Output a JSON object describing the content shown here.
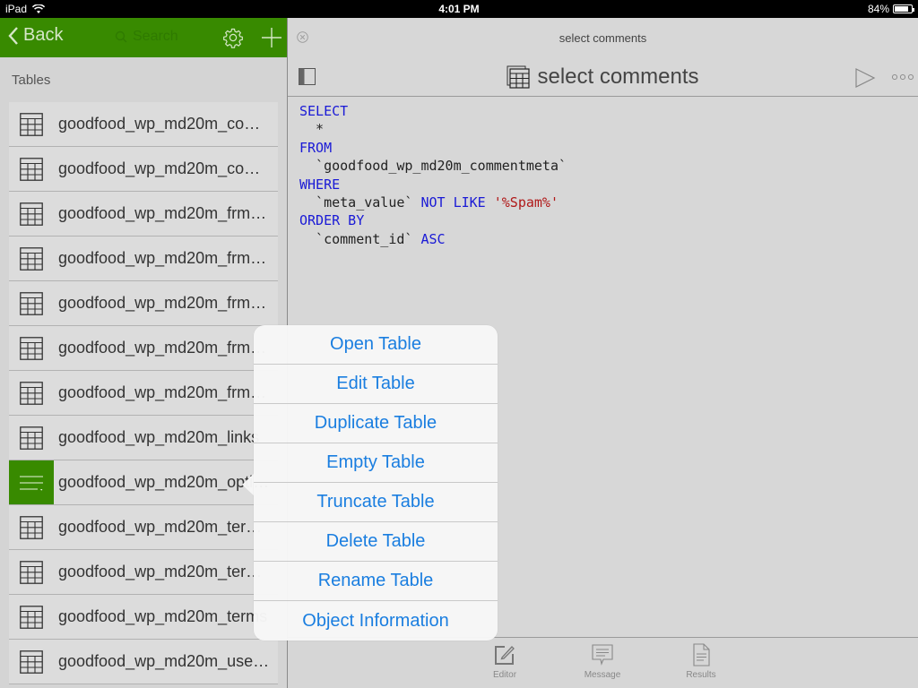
{
  "status_bar": {
    "device": "iPad",
    "time": "4:01 PM",
    "battery": "84%",
    "battery_level": 0.84
  },
  "sidebar": {
    "back_label": "Back",
    "search_placeholder": "Search",
    "section_title": "Tables",
    "tables": [
      {
        "name": "goodfood_wp_md20m_com…"
      },
      {
        "name": "goodfood_wp_md20m_com…"
      },
      {
        "name": "goodfood_wp_md20m_frm_…"
      },
      {
        "name": "goodfood_wp_md20m_frm_…"
      },
      {
        "name": "goodfood_wp_md20m_frm_…"
      },
      {
        "name": "goodfood_wp_md20m_frm_…"
      },
      {
        "name": "goodfood_wp_md20m_frm_…"
      },
      {
        "name": "goodfood_wp_md20m_links"
      },
      {
        "name": "goodfood_wp_md20m_opti…",
        "selected": true
      },
      {
        "name": "goodfood_wp_md20m_ter…"
      },
      {
        "name": "goodfood_wp_md20m_ter…"
      },
      {
        "name": "goodfood_wp_md20m_terms"
      },
      {
        "name": "goodfood_wp_md20m_user…"
      }
    ]
  },
  "main": {
    "tab_title": "select comments",
    "query_title": "select comments",
    "sql": {
      "l1": "SELECT",
      "l2": "  *",
      "l3": "FROM",
      "l4": "  `goodfood_wp_md20m_commentmeta`",
      "l5": "WHERE",
      "l6a": "  `meta_value` ",
      "l6b": "NOT LIKE",
      "l6c": "'%Spam%'",
      "l7": "ORDER BY",
      "l8a": "  `comment_id` ",
      "l8b": "ASC"
    },
    "bottom_tabs": {
      "editor": "Editor",
      "message": "Message",
      "results": "Results"
    }
  },
  "context_menu": {
    "items": [
      "Open Table",
      "Edit Table",
      "Duplicate Table",
      "Empty Table",
      "Truncate Table",
      "Delete Table",
      "Rename Table",
      "Object Information"
    ]
  },
  "colors": {
    "accent_green": "#388a00",
    "link_blue": "#1a7ee0",
    "keyword_blue": "#1a1ad6",
    "string_red": "#b01818"
  }
}
